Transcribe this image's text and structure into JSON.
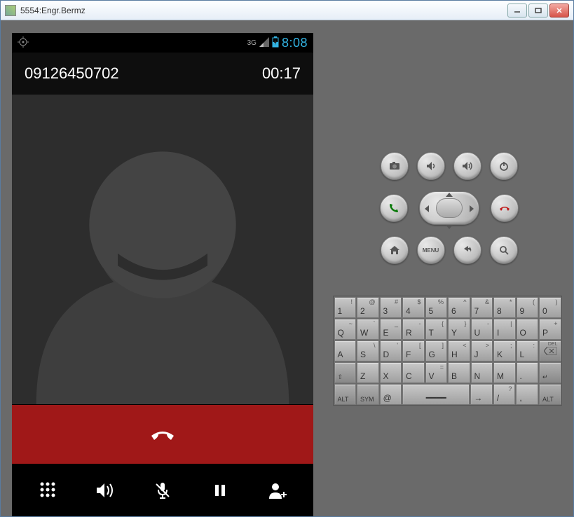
{
  "window": {
    "title": "5554:Engr.Bermz"
  },
  "status": {
    "network_label": "3G",
    "clock": "8:08"
  },
  "call": {
    "number": "09126450702",
    "duration": "00:17"
  },
  "hw": {
    "menu_label": "MENU"
  },
  "keyboard": {
    "rows": [
      [
        {
          "main": "1",
          "sup": "!"
        },
        {
          "main": "2",
          "sup": "@"
        },
        {
          "main": "3",
          "sup": "#"
        },
        {
          "main": "4",
          "sup": "$"
        },
        {
          "main": "5",
          "sup": "%"
        },
        {
          "main": "6",
          "sup": "^"
        },
        {
          "main": "7",
          "sup": "&"
        },
        {
          "main": "8",
          "sup": "*"
        },
        {
          "main": "9",
          "sup": "("
        },
        {
          "main": "0",
          "sup": ")"
        }
      ],
      [
        {
          "main": "Q",
          "sup": "~"
        },
        {
          "main": "W",
          "sup": "`"
        },
        {
          "main": "E",
          "sup": "_"
        },
        {
          "main": "R",
          "sup": "-"
        },
        {
          "main": "T",
          "sup": "{"
        },
        {
          "main": "Y",
          "sup": "}"
        },
        {
          "main": "U",
          "sup": "-"
        },
        {
          "main": "I",
          "sup": "|"
        },
        {
          "main": "O",
          "sup": ""
        },
        {
          "main": "P",
          "sup": "+"
        }
      ],
      [
        {
          "main": "A",
          "sup": ""
        },
        {
          "main": "S",
          "sup": "\\"
        },
        {
          "main": "D",
          "sup": "'"
        },
        {
          "main": "F",
          "sup": "["
        },
        {
          "main": "G",
          "sup": "]"
        },
        {
          "main": "H",
          "sup": "<"
        },
        {
          "main": "J",
          "sup": ">"
        },
        {
          "main": "K",
          "sup": ";"
        },
        {
          "main": "L",
          "sup": ":"
        },
        {
          "main": "DEL",
          "sup": "",
          "special": true,
          "icon": "del"
        }
      ],
      [
        {
          "main": "⇧",
          "sup": "",
          "special": true
        },
        {
          "main": "Z",
          "sup": ""
        },
        {
          "main": "X",
          "sup": ""
        },
        {
          "main": "C",
          "sup": ""
        },
        {
          "main": "V",
          "sup": "="
        },
        {
          "main": "B",
          "sup": ""
        },
        {
          "main": "N",
          "sup": ""
        },
        {
          "main": "M",
          "sup": ""
        },
        {
          "main": ".",
          "sup": ""
        },
        {
          "main": "↵",
          "sup": "",
          "special": true
        }
      ],
      [
        {
          "main": "ALT",
          "sup": "",
          "special": true,
          "wide": "1"
        },
        {
          "main": "SYM",
          "sup": "",
          "special": true,
          "wide": "1"
        },
        {
          "main": "@",
          "sup": "",
          "wide": "1"
        },
        {
          "main": "",
          "sup": "",
          "wide": "4",
          "space": true
        },
        {
          "main": "→",
          "sup": "",
          "wide": "1"
        },
        {
          "main": "/",
          "sup": "?",
          "wide": "1"
        },
        {
          "main": ",",
          "sup": "",
          "wide": "1"
        },
        {
          "main": "ALT",
          "sup": "",
          "special": true,
          "wide": "1"
        }
      ]
    ]
  }
}
